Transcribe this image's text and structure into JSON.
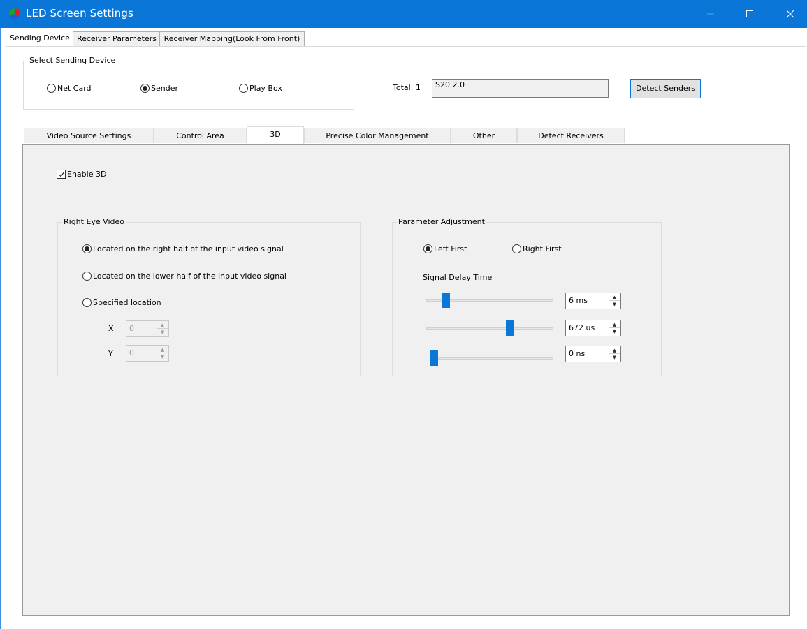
{
  "window": {
    "title": "LED Screen Settings",
    "accent_color": "#0a76d8",
    "controls": [
      "minimize-icon",
      "maximize-icon",
      "close-icon"
    ]
  },
  "top_tabs": [
    {
      "label": "Sending Device",
      "active": true
    },
    {
      "label": "Receiver Parameters",
      "active": false
    },
    {
      "label": "Receiver Mapping(Look From Front)",
      "active": false
    }
  ],
  "select_device": {
    "title": "Select Sending Device",
    "options": [
      {
        "label": "Net Card",
        "selected": false
      },
      {
        "label": "Sender",
        "selected": true
      },
      {
        "label": "Play Box",
        "selected": false
      }
    ]
  },
  "total": {
    "label": "Total: 1",
    "value": "S20 2.0"
  },
  "detect_senders_label": "Detect Senders",
  "sub_tabs": [
    {
      "label": "Video Source Settings",
      "active": false
    },
    {
      "label": "Control Area",
      "active": false
    },
    {
      "label": "3D",
      "active": true
    },
    {
      "label": "Precise Color Management",
      "active": false
    },
    {
      "label": "Other",
      "active": false
    },
    {
      "label": "Detect Receivers",
      "active": false
    }
  ],
  "enable_3d": {
    "label": "Enable 3D",
    "checked": true
  },
  "right_eye": {
    "title": "Right Eye Video",
    "options": [
      {
        "label": "Located on the right half of the input video signal",
        "selected": true
      },
      {
        "label": "Located on the lower half of the input video signal",
        "selected": false
      },
      {
        "label": "Specified location",
        "selected": false
      }
    ],
    "x_label": "X",
    "x_value": "0",
    "y_label": "Y",
    "y_value": "0"
  },
  "param_adjust": {
    "title": "Parameter Adjustment",
    "order_options": [
      {
        "label": "Left First",
        "selected": true
      },
      {
        "label": "Right First",
        "selected": false
      }
    ],
    "delay_label": "Signal Delay Time",
    "sliders": [
      {
        "value_text": "6 ms",
        "level": 0.13
      },
      {
        "value_text": "672 us",
        "level": 0.67
      },
      {
        "value_text": "0 ns",
        "level": 0.0
      }
    ]
  }
}
